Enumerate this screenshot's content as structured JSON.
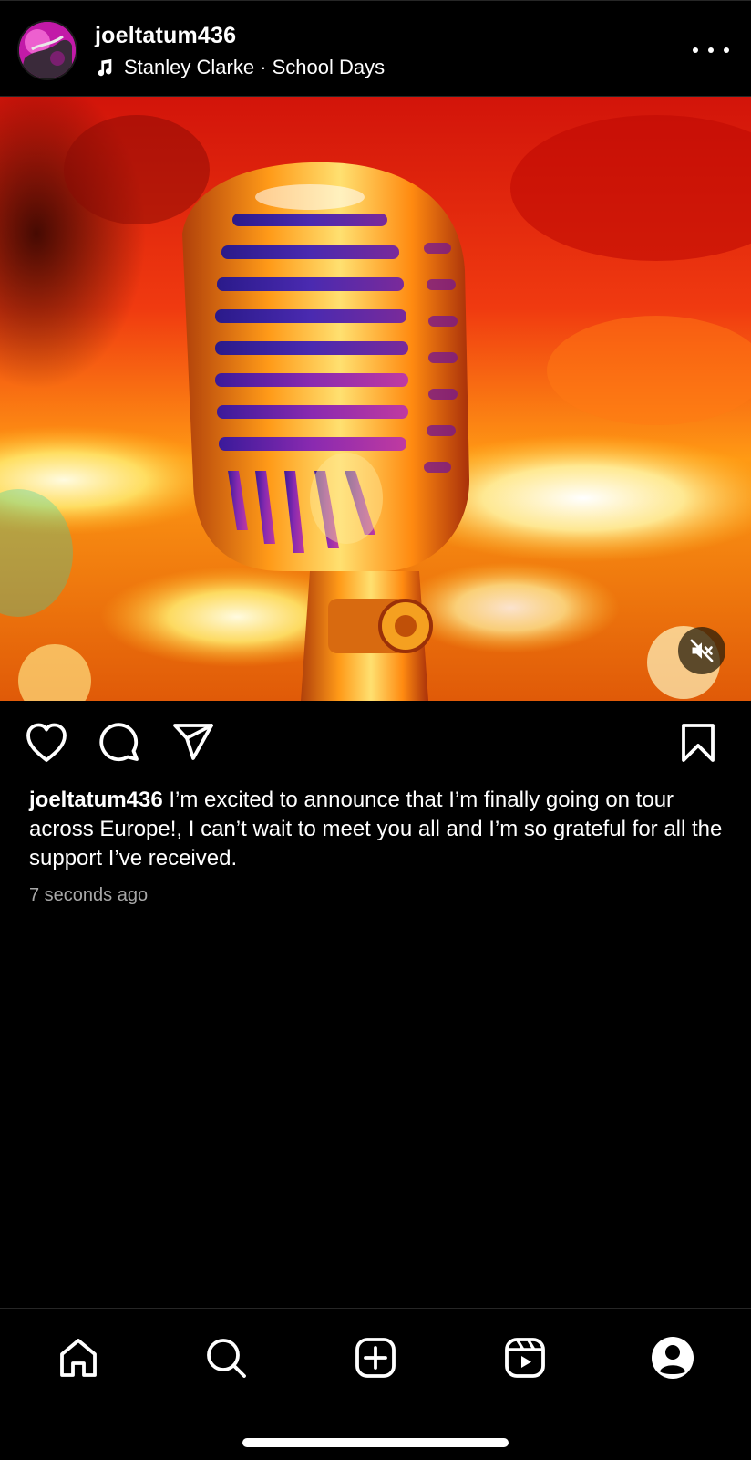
{
  "post": {
    "username": "joeltatum436",
    "audio": "Stanley Clarke · School Days",
    "caption_user": "joeltatum436",
    "caption_text": " I’m excited to announce that I’m finally going on tour across Europe!, I can’t wait to meet you all and I’m so grateful for all the support I’ve received.",
    "timestamp": "7 seconds ago",
    "muted": true
  },
  "icons": {
    "header": [
      "music-note-icon",
      "more-options-icon"
    ],
    "media": [
      "mute-icon"
    ],
    "actions": [
      "heart-icon",
      "comment-icon",
      "share-icon",
      "bookmark-icon"
    ],
    "tabs": [
      "home-icon",
      "search-icon",
      "create-icon",
      "reels-icon",
      "profile-icon"
    ]
  },
  "colors": {
    "background": "#000000",
    "text": "#ffffff",
    "secondary_text": "#a8a8a8"
  }
}
